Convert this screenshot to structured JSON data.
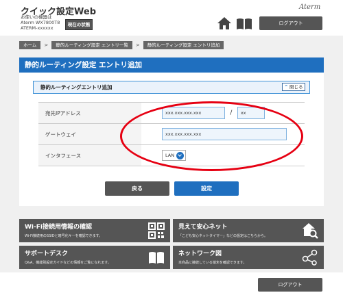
{
  "header": {
    "app_title": "クイック設定Web",
    "device_line1": "お使いの機器は",
    "device_line2": "Aterm WX7800T8",
    "device_line3": "ATERM-xxxxxx",
    "status_button": "現在の状態",
    "brand": "Aterm",
    "logout": "ログアウト"
  },
  "breadcrumb": [
    "ホーム",
    "静的ルーティング設定 エントリ一覧",
    "静的ルーティング設定 エントリ追加"
  ],
  "panel": {
    "title": "静的ルーティング設定 エントリ追加",
    "section_label": "静的ルーティングエントリ追加",
    "close_label": "閉じる"
  },
  "form": {
    "dest_label": "宛先IPアドレス",
    "dest_value": "xxx.xxx.xxx.xxx",
    "dest_mask": "xx",
    "gateway_label": "ゲートウェイ",
    "gateway_value": "xxx.xxx.xxx.xxx",
    "interface_label": "インタフェース",
    "interface_value": "LAN"
  },
  "buttons": {
    "back": "戻る",
    "set": "設定"
  },
  "tiles": [
    {
      "title": "Wi-Fi接続用情報の確認",
      "desc": "Wi-Fi接続用のSSIDと暗号化キーを確認できます。"
    },
    {
      "title": "見えて安心ネット",
      "desc": "「こども安心ネットタイマー」などの設定はこちらから。"
    },
    {
      "title": "サポートデスク",
      "desc": "Q&A、機能別設定ガイドなどの情報をご覧になれます。"
    },
    {
      "title": "ネットワーク図",
      "desc": "本商品に接続している端末を確認できます。"
    }
  ],
  "footer": {
    "logout": "ログアウト"
  },
  "colors": {
    "accent": "#1f6fbf",
    "dark": "#555555",
    "highlight": "#e60012"
  }
}
